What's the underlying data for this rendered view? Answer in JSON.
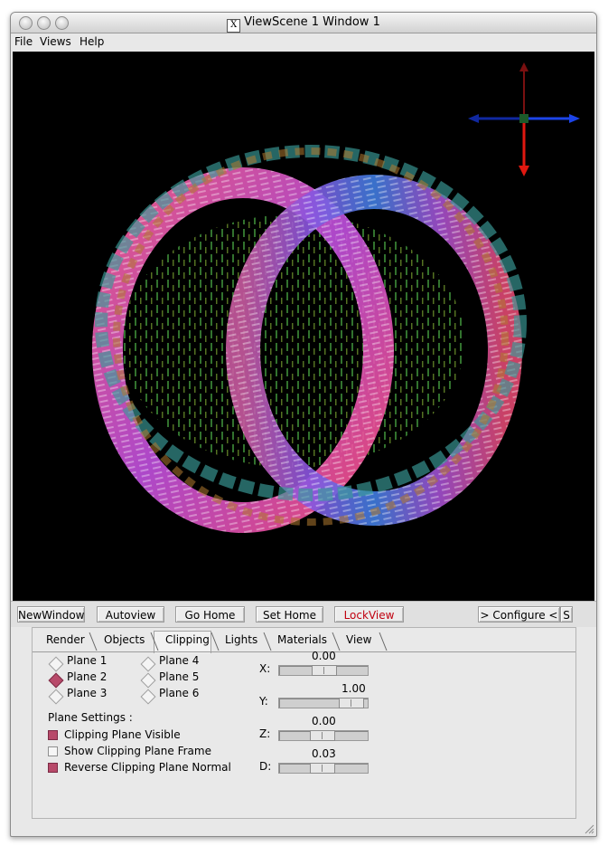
{
  "window": {
    "title": "ViewScene 1 Window 1",
    "x_icon": "X"
  },
  "menubar": {
    "file": "File",
    "views": "Views",
    "help": "Help"
  },
  "toolbar": {
    "new_window": "NewWindow",
    "autoview": "Autoview",
    "go_home": "Go Home",
    "set_home": "Set Home",
    "lock_view": "LockView",
    "configure": "> Configure <",
    "s": "S"
  },
  "tabs": [
    "Render",
    "Objects",
    "Clipping",
    "Lights",
    "Materials",
    "View"
  ],
  "active_tab": "Clipping",
  "clipping": {
    "planes": [
      {
        "label": "Plane 1",
        "selected": false
      },
      {
        "label": "Plane 2",
        "selected": true
      },
      {
        "label": "Plane 3",
        "selected": false
      },
      {
        "label": "Plane 4",
        "selected": false
      },
      {
        "label": "Plane 5",
        "selected": false
      },
      {
        "label": "Plane 6",
        "selected": false
      }
    ],
    "settings_label": "Plane Settings :",
    "options": [
      {
        "label": "Clipping Plane Visible",
        "checked": true
      },
      {
        "label": "Show Clipping Plane Frame",
        "checked": false
      },
      {
        "label": "Reverse Clipping Plane Normal",
        "checked": true
      }
    ],
    "sliders": [
      {
        "label": "X:",
        "value": "0.00",
        "fraction": 0.5
      },
      {
        "label": "Y:",
        "value": "1.00",
        "fraction": 0.78
      },
      {
        "label": "Z:",
        "value": "0.00",
        "fraction": 0.43
      },
      {
        "label": "D:",
        "value": "0.03",
        "fraction": 0.43
      }
    ]
  },
  "colors": {
    "accent": "#b84a6a",
    "lockview_text": "#c0000f",
    "viewport_bg": "#000000"
  },
  "icons": [
    "x11-icon",
    "axes-widget-icon",
    "resize-grip-icon"
  ]
}
